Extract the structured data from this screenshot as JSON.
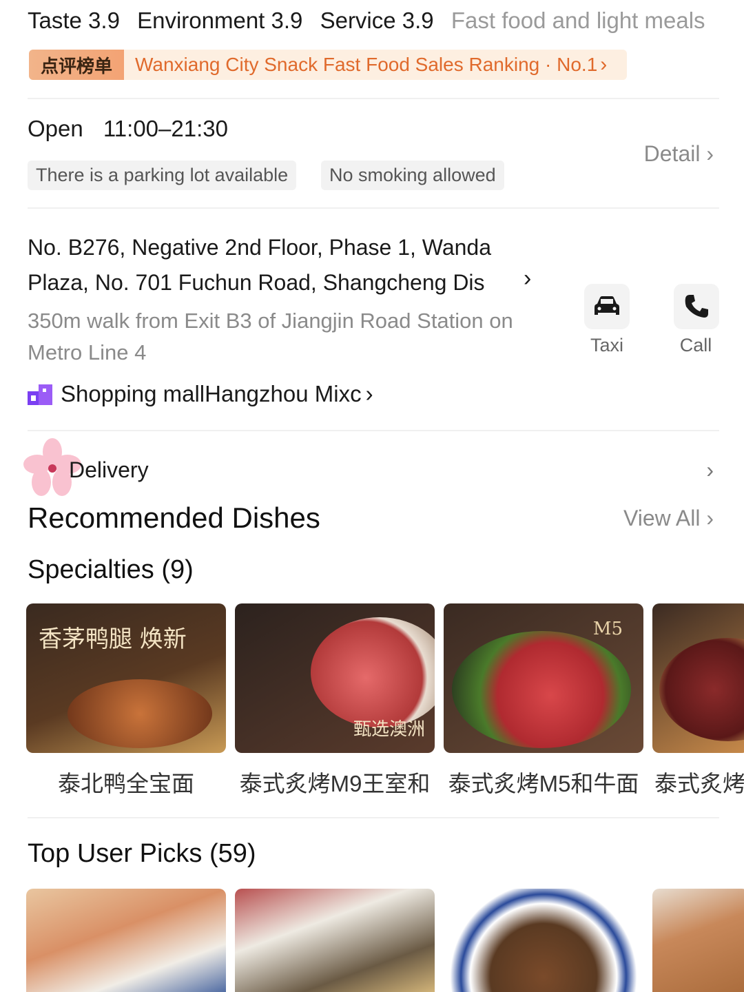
{
  "ratings": {
    "taste": "Taste 3.9",
    "environment": "Environment 3.9",
    "service": "Service 3.9",
    "category": "Fast food and light meals"
  },
  "ranking": {
    "badge": "点评榜单",
    "text": "Wanxiang City Snack Fast Food Sales Ranking · No.1"
  },
  "hours": {
    "label": "Open",
    "value": "11:00–21:30"
  },
  "tags": [
    "There is a parking lot available",
    "No smoking allowed"
  ],
  "detail_label": "Detail",
  "address": {
    "line": "No. B276, Negative 2nd Floor, Phase 1, Wanda Plaza, No. 701 Fuchun Road, Shangcheng Dis",
    "metro": "350m walk from Exit B3 of Jiangjin Road Station on Metro Line 4"
  },
  "actions": {
    "taxi": "Taxi",
    "call": "Call"
  },
  "mall": {
    "prefix": "Shopping mall",
    "name": "Hangzhou Mixc"
  },
  "delivery_label": "Delivery",
  "recommended": {
    "title": "Recommended Dishes",
    "view_all": "View All",
    "specialties_title": "Specialties (9)",
    "dishes": [
      {
        "name": "泰北鸭全宝面",
        "image_text": "香茅鸭腿 焕新"
      },
      {
        "name": "泰式炙烤M9王室和",
        "image_text": "甄选澳洲"
      },
      {
        "name": "泰式炙烤M5和牛面",
        "image_text": "M5"
      },
      {
        "name": "泰式炙烤"
      }
    ],
    "top_picks_title": "Top User Picks (59)"
  }
}
